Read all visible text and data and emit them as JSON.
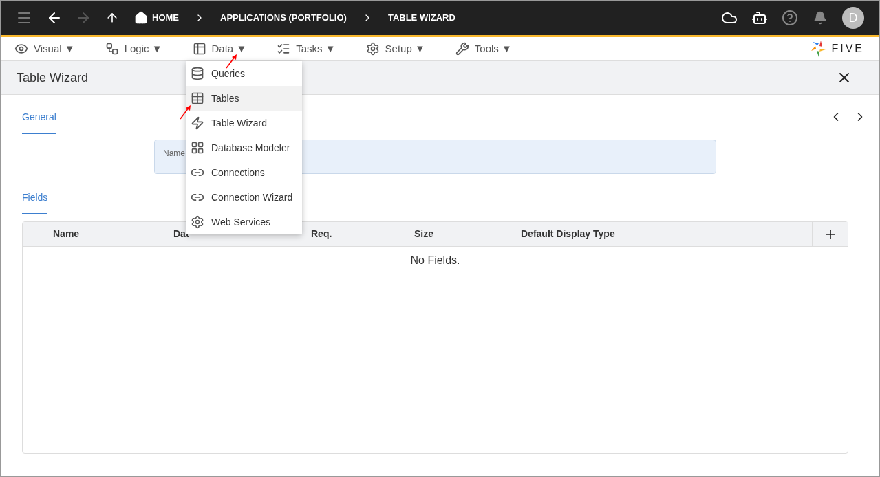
{
  "top_bar": {
    "breadcrumbs": [
      {
        "label": "HOME"
      },
      {
        "label": "APPLICATIONS (PORTFOLIO)"
      },
      {
        "label": "TABLE WIZARD"
      }
    ],
    "avatar": "D"
  },
  "menu_bar": {
    "items": [
      {
        "label": "Visual",
        "caret": "▼"
      },
      {
        "label": "Logic",
        "caret": "▼"
      },
      {
        "label": "Data",
        "caret": "▼"
      },
      {
        "label": "Tasks",
        "caret": "▼"
      },
      {
        "label": "Setup",
        "caret": "▼"
      },
      {
        "label": "Tools",
        "caret": "▼"
      }
    ],
    "logo": "FIVE"
  },
  "dropdown": {
    "items": [
      {
        "label": "Queries",
        "selected": false
      },
      {
        "label": "Tables",
        "selected": true
      },
      {
        "label": "Table Wizard",
        "selected": false
      },
      {
        "label": "Database Modeler",
        "selected": false
      },
      {
        "label": "Connections",
        "selected": false
      },
      {
        "label": "Connection Wizard",
        "selected": false
      },
      {
        "label": "Web Services",
        "selected": false
      }
    ]
  },
  "panel": {
    "title": "Table Wizard",
    "sections": [
      {
        "label": "General"
      },
      {
        "label": "Fields"
      }
    ],
    "name_field": {
      "label": "Name"
    },
    "table": {
      "columns": [
        {
          "label": "Name"
        },
        {
          "label": "Dat"
        },
        {
          "label": "Req."
        },
        {
          "label": "Size"
        },
        {
          "label": "Default Display Type"
        }
      ],
      "empty_text": "No Fields."
    }
  }
}
